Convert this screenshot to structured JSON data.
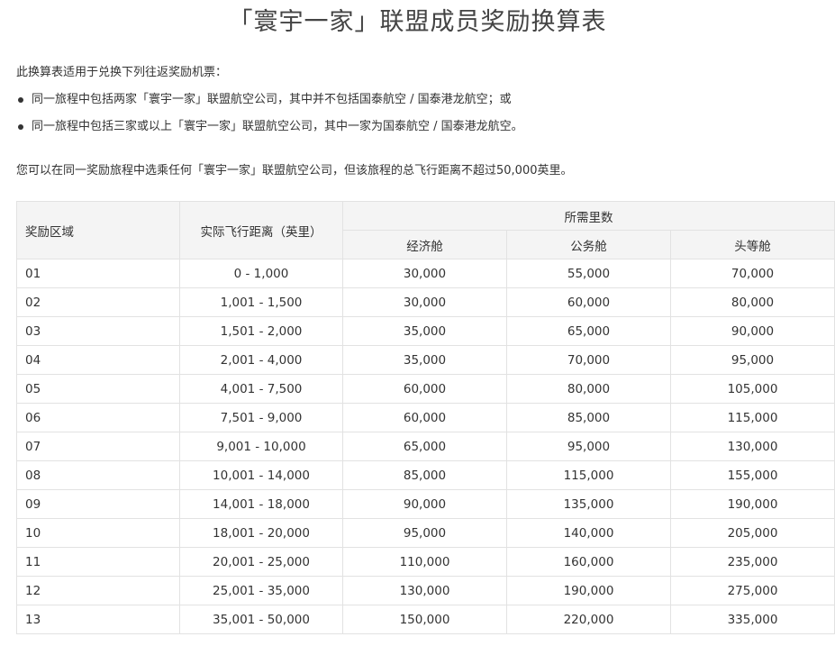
{
  "title": "「寰宇一家」联盟成员奖励换算表",
  "intro": "此换算表适用于兑换下列往返奖励机票：",
  "conditions": [
    "同一旅程中包括两家「寰宇一家」联盟航空公司，其中并不包括国泰航空 / 国泰港龙航空；或",
    "同一旅程中包括三家或以上「寰宇一家」联盟航空公司，其中一家为国泰航空 / 国泰港龙航空。"
  ],
  "note": "您可以在同一奖励旅程中选乘任何「寰宇一家」联盟航空公司，但该旅程的总飞行距离不超过50,000英里。",
  "table": {
    "headers": {
      "zone": "奖励区域",
      "distance": "实际飞行距离（英里）",
      "miles_required": "所需里数",
      "economy": "经济舱",
      "business": "公务舱",
      "first": "头等舱"
    },
    "rows": [
      {
        "zone": "01",
        "distance": "0 - 1,000",
        "economy": "30,000",
        "business": "55,000",
        "first": "70,000"
      },
      {
        "zone": "02",
        "distance": "1,001 - 1,500",
        "economy": "30,000",
        "business": "60,000",
        "first": "80,000"
      },
      {
        "zone": "03",
        "distance": "1,501 - 2,000",
        "economy": "35,000",
        "business": "65,000",
        "first": "90,000"
      },
      {
        "zone": "04",
        "distance": "2,001 - 4,000",
        "economy": "35,000",
        "business": "70,000",
        "first": "95,000"
      },
      {
        "zone": "05",
        "distance": "4,001 - 7,500",
        "economy": "60,000",
        "business": "80,000",
        "first": "105,000"
      },
      {
        "zone": "06",
        "distance": "7,501 - 9,000",
        "economy": "60,000",
        "business": "85,000",
        "first": "115,000"
      },
      {
        "zone": "07",
        "distance": "9,001 - 10,000",
        "economy": "65,000",
        "business": "95,000",
        "first": "130,000"
      },
      {
        "zone": "08",
        "distance": "10,001 - 14,000",
        "economy": "85,000",
        "business": "115,000",
        "first": "155,000"
      },
      {
        "zone": "09",
        "distance": "14,001 - 18,000",
        "economy": "90,000",
        "business": "135,000",
        "first": "190,000"
      },
      {
        "zone": "10",
        "distance": "18,001 - 20,000",
        "economy": "95,000",
        "business": "140,000",
        "first": "205,000"
      },
      {
        "zone": "11",
        "distance": "20,001 - 25,000",
        "economy": "110,000",
        "business": "160,000",
        "first": "235,000"
      },
      {
        "zone": "12",
        "distance": "25,001 - 35,000",
        "economy": "130,000",
        "business": "190,000",
        "first": "275,000"
      },
      {
        "zone": "13",
        "distance": "35,001 - 50,000",
        "economy": "150,000",
        "business": "220,000",
        "first": "335,000"
      }
    ]
  }
}
